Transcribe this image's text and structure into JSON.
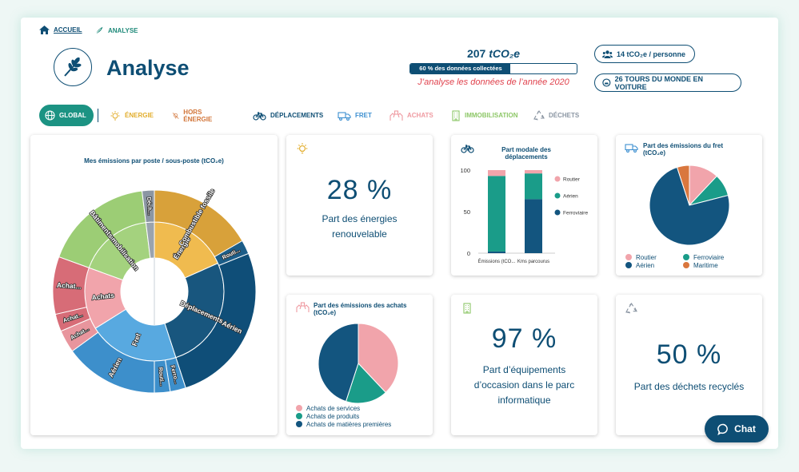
{
  "breadcrumb": {
    "home": "ACCUEIL",
    "current": "ANALYSE"
  },
  "header": {
    "title": "Analyse",
    "total_value": "207",
    "total_unit": "tCO₂e",
    "progress": 0.6,
    "progress_label": "60 % des données collectées",
    "year_note": "J’analyse les données de l’année 2020",
    "per_person": "14 tCO₂e / personne",
    "world_tours": "26 TOURS DU MONDE EN VOITURE"
  },
  "tabs": [
    {
      "label": "GLOBAL",
      "icon": "globe-icon",
      "color": "#ffffff"
    },
    {
      "label": "ÉNERGIE",
      "icon": "lightbulb-icon",
      "color": "#e2ad2b"
    },
    {
      "label": "HORS ÉNERGIE",
      "icon": "crossed-bulb-icon",
      "color": "#d2763a"
    },
    {
      "label": "DÉPLACEMENTS",
      "icon": "bicycle-icon",
      "color": "#0e4e74"
    },
    {
      "label": "FRET",
      "icon": "truck-icon",
      "color": "#3c8fd0"
    },
    {
      "label": "ACHATS",
      "icon": "hands-icon",
      "color": "#ef9aa1"
    },
    {
      "label": "IMMOBILISATION",
      "icon": "building-icon",
      "color": "#8dc767"
    },
    {
      "label": "DÉCHETS",
      "icon": "recycle-icon",
      "color": "#8b96a3"
    }
  ],
  "sunburst": {
    "title": "Mes émissions par poste / sous-poste (tCO₂e)",
    "inner": [
      {
        "label": "Énergie",
        "start": 0,
        "end": 66,
        "color": "#f0bb4f"
      },
      {
        "label": "Déplacements",
        "start": 66,
        "end": 162,
        "color": "#18567e"
      },
      {
        "label": "Fret",
        "start": 162,
        "end": 238,
        "color": "#58a9e0"
      },
      {
        "label": "Achats",
        "start": 238,
        "end": 290,
        "color": "#f1a4ab"
      },
      {
        "label": "Immobilisation",
        "start": 290,
        "end": 353,
        "color": "#a4d27e"
      },
      {
        "label": "",
        "start": 353,
        "end": 360,
        "color": "#9aa3ae"
      }
    ],
    "outer": [
      {
        "label": "Combustible fossile",
        "start": 0,
        "end": 60,
        "color": "#d8a13a"
      },
      {
        "label": "Routi...",
        "start": 60,
        "end": 68,
        "color": "#1c5d88"
      },
      {
        "label": "Aérien",
        "start": 68,
        "end": 162,
        "color": "#0f4e78"
      },
      {
        "label": "Ferro...",
        "start": 162,
        "end": 171,
        "color": "#3d8fcb"
      },
      {
        "label": "Routi...",
        "start": 171,
        "end": 180,
        "color": "#3d8fcb"
      },
      {
        "label": "Aérien",
        "start": 180,
        "end": 234,
        "color": "#3d8fcb"
      },
      {
        "label": "Achat...",
        "start": 234,
        "end": 247,
        "color": "#e8959d"
      },
      {
        "label": "Achat...",
        "start": 247,
        "end": 257,
        "color": "#d76c77"
      },
      {
        "label": "Achat...",
        "start": 257,
        "end": 290,
        "color": "#d76c77"
      },
      {
        "label": "Bâtiments",
        "start": 290,
        "end": 353,
        "color": "#9ccd75"
      },
      {
        "label": "Déch...",
        "start": 353,
        "end": 360,
        "color": "#8b96a3"
      }
    ]
  },
  "cards": {
    "energy": {
      "value": "28 %",
      "label": "Part des énergies renouvelable",
      "icon": "lightbulb-icon"
    },
    "modal": {
      "title": "Part modale des déplacements",
      "icon": "bicycle-icon",
      "legend": [
        {
          "label": "Routier",
          "color": "#f1a4ab"
        },
        {
          "label": "Aérien",
          "color": "#1a9c89"
        },
        {
          "label": "Ferroviaire",
          "color": "#13557f"
        }
      ]
    },
    "fret": {
      "title": "Part des émissions du fret (tCO₂e)",
      "icon": "truck-icon",
      "legend": [
        {
          "label": "Routier",
          "color": "#f1a4ab"
        },
        {
          "label": "Ferroviaire",
          "color": "#1a9c89"
        },
        {
          "label": "Aérien",
          "color": "#13557f"
        },
        {
          "label": "Maritime",
          "color": "#d9773e"
        }
      ]
    },
    "achats": {
      "title": "Part des émissions des achats (tCO₂e)",
      "icon": "hands-icon",
      "legend": [
        {
          "label": "Achats de services",
          "color": "#f1a4ab"
        },
        {
          "label": "Achats de produits",
          "color": "#1a9c89"
        },
        {
          "label": "Achats de matières premières",
          "color": "#13557f"
        }
      ]
    },
    "immo": {
      "value": "97 %",
      "label": "Part d’équipements d’occasion dans le parc informatique",
      "icon": "building-icon"
    },
    "dechets": {
      "value": "50 %",
      "label": "Part des déchets recyclés",
      "icon": "recycle-icon"
    }
  },
  "chart_data": [
    {
      "type": "bar",
      "title": "Part modale des déplacements",
      "categories": [
        "Émissions (tCO...",
        "Kms parcourus"
      ],
      "ylim": [
        0,
        100
      ],
      "yticks": [
        0,
        50,
        100
      ],
      "stacked": true,
      "series": [
        {
          "name": "Ferroviaire",
          "values": [
            2,
            65
          ]
        },
        {
          "name": "Aérien",
          "values": [
            91,
            31
          ]
        },
        {
          "name": "Routier",
          "values": [
            7,
            4
          ]
        }
      ]
    },
    {
      "type": "pie",
      "title": "Part des émissions du fret (tCO₂e)",
      "labels": [
        "Routier",
        "Ferroviaire",
        "Aérien",
        "Maritime"
      ],
      "values": [
        12,
        9,
        74,
        5
      ]
    },
    {
      "type": "pie",
      "title": "Part des émissions des achats (tCO₂e)",
      "labels": [
        "Achats de services",
        "Achats de produits",
        "Achats de matières premières"
      ],
      "values": [
        38,
        17,
        45
      ]
    }
  ],
  "chat": {
    "label": "Chat"
  }
}
